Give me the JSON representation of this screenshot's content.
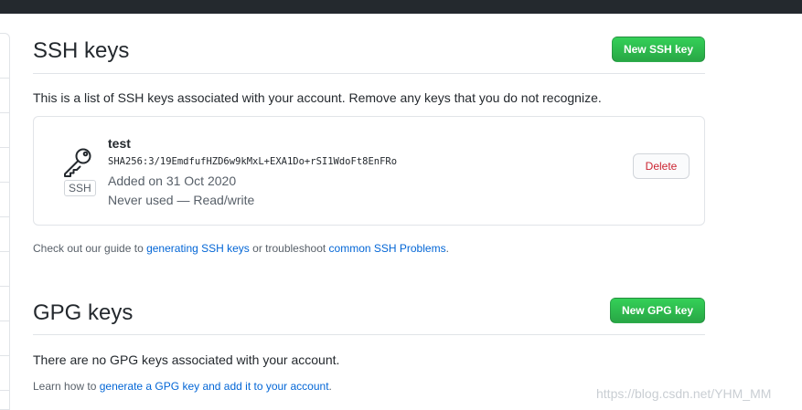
{
  "ssh": {
    "title": "SSH keys",
    "new_button": "New SSH key",
    "intro": "This is a list of SSH keys associated with your account. Remove any keys that you do not recognize.",
    "keys": [
      {
        "title": "test",
        "fingerprint": "SHA256:3/19EmdfufHZD6w9kMxL+EXA1Do+rSI1WdoFt8EnFRo",
        "added": "Added on 31 Oct 2020",
        "usage": "Never used — Read/write",
        "type_label": "SSH",
        "icon": "key-icon",
        "delete_label": "Delete"
      }
    ],
    "guide": {
      "prefix": "Check out our guide to ",
      "link1": "generating SSH keys",
      "middle": " or troubleshoot ",
      "link2": "common SSH Problems",
      "suffix": "."
    }
  },
  "gpg": {
    "title": "GPG keys",
    "new_button": "New GPG key",
    "empty_text": "There are no GPG keys associated with your account.",
    "learn": {
      "prefix": "Learn how to ",
      "link": "generate a GPG key and add it to your account",
      "suffix": "."
    }
  },
  "watermark": "https://blog.csdn.net/YHM_MM",
  "colors": {
    "accent_green": "#28a745",
    "danger_red": "#cb2431",
    "link_blue": "#0366d6",
    "topbar": "#24292e"
  }
}
